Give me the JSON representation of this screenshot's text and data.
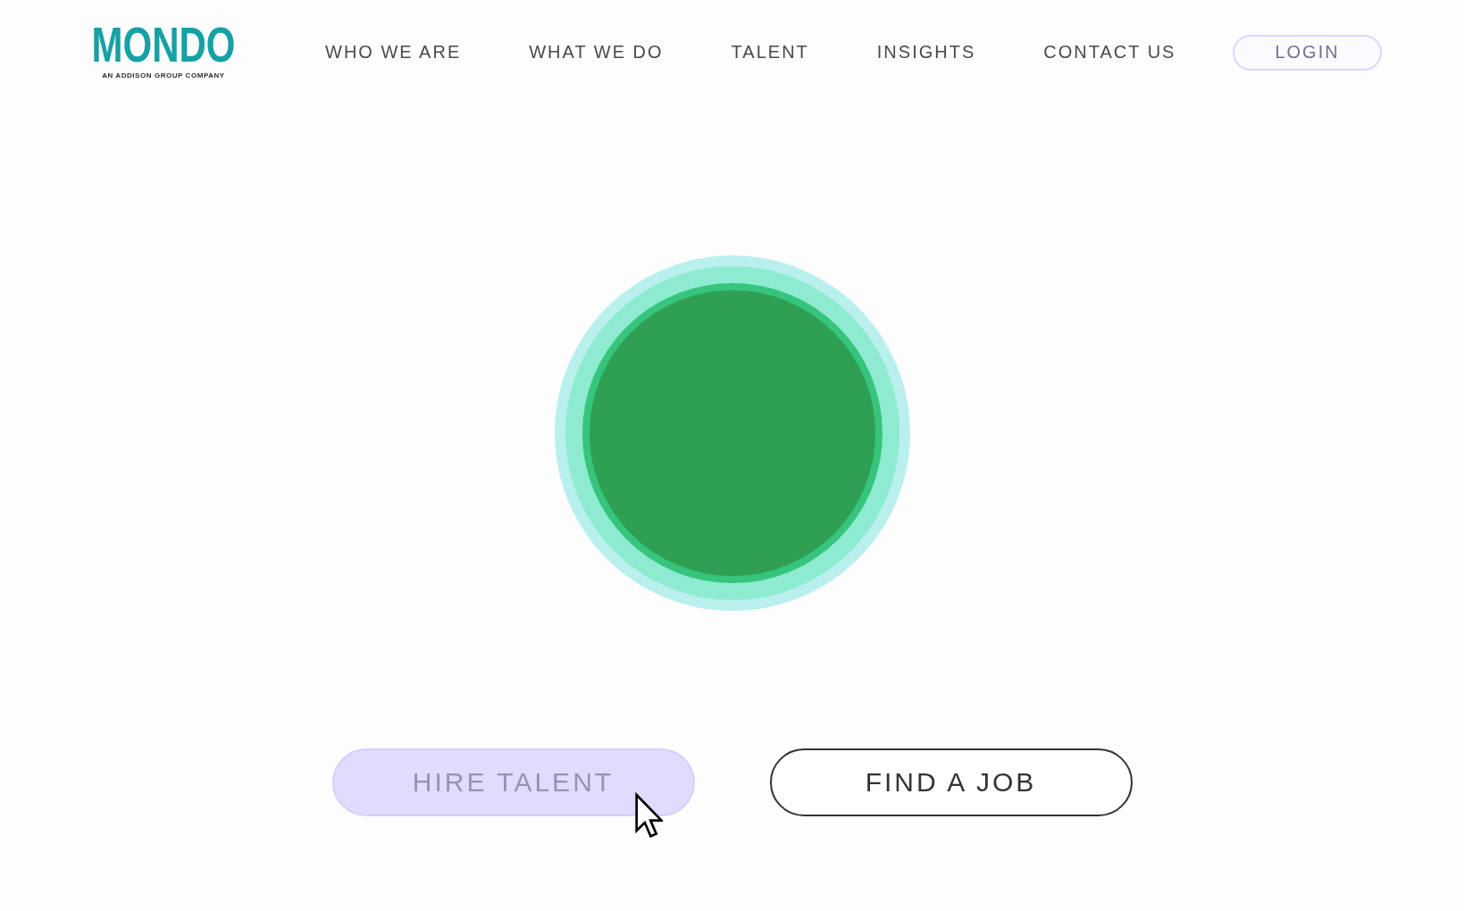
{
  "logo": {
    "wordmark": "MONDO",
    "tagline": "AN ADDISON GROUP COMPANY"
  },
  "nav": {
    "items": [
      "WHO WE ARE",
      "WHAT WE DO",
      "TALENT",
      "INSIGHTS",
      "CONTACT US"
    ],
    "login": {
      "label": "LOGIN"
    }
  },
  "hero": {
    "buttons": [
      {
        "label": "HIRE TALENT",
        "hovered": true
      },
      {
        "label": "FIND A JOB",
        "hovered": false
      }
    ]
  }
}
